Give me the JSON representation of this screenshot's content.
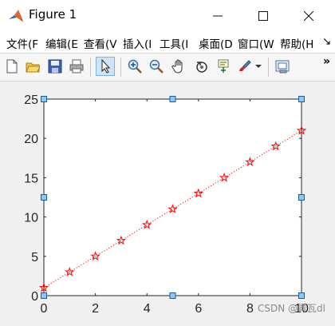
{
  "window": {
    "title": "Figure 1",
    "minimize_icon": "minimize-icon",
    "maximize_icon": "maximize-icon",
    "close_icon": "close-icon"
  },
  "menu": {
    "items": [
      "文件(F",
      "编辑(E",
      "查看(V",
      "插入(I",
      "工具(I",
      "桌面(D",
      "窗口(W",
      "帮助(H"
    ],
    "overflow_icon": "arrow-icon"
  },
  "toolbar": {
    "icons": [
      "new-figure-icon",
      "open-icon",
      "save-icon",
      "print-icon",
      "select-arrow-icon",
      "zoom-in-icon",
      "zoom-out-icon",
      "pan-hand-icon",
      "rotate-3d-icon",
      "data-cursor-icon",
      "brush-icon",
      "dropdown-icon",
      "plot-tools-icon"
    ],
    "overflow_label": "»"
  },
  "chart_data": {
    "type": "line",
    "x": [
      0,
      1,
      2,
      3,
      4,
      5,
      6,
      7,
      8,
      9,
      10
    ],
    "y": [
      1,
      3,
      5,
      7,
      9,
      11,
      13,
      15,
      17,
      19,
      21
    ],
    "line_style": "dotted",
    "marker": "pentagram",
    "color": "#ff0000",
    "xlim": [
      0,
      10
    ],
    "ylim": [
      0,
      25
    ],
    "xticks": [
      0,
      2,
      4,
      6,
      8,
      10
    ],
    "yticks": [
      0,
      5,
      10,
      15,
      20,
      25
    ],
    "xticklabels": [
      "0",
      "2",
      "4",
      "6",
      "8",
      "10"
    ],
    "yticklabels": [
      "0",
      "5",
      "10",
      "15",
      "20",
      "25"
    ],
    "grid": false,
    "axes_selected": true
  },
  "watermark": "CSDN @青瓦dl"
}
